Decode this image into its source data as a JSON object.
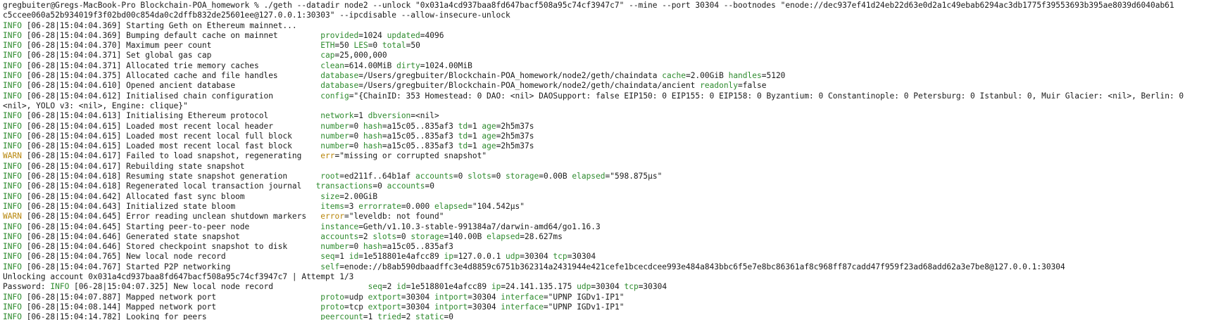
{
  "colors": {
    "info": "#2e8b2e",
    "warn": "#b8860b",
    "text": "#1a1a1a",
    "cursor": "#8a8a8a"
  },
  "lines": [
    {
      "segs": [
        {
          "t": "gregbuiter@Gregs-MacBook-Pro Blockchain-POA_homework % ./geth --datadir node2 --unlock \"0x031a4cd937baa8fd647bacf508a95c74cf3947c7\" --mine --port 30304 --bootnodes \"enode://dec937ef41d24eb22d63e0d2a1c49ebab6294ac3db1775f39553693b395ae8039d6040ab61"
        }
      ]
    },
    {
      "segs": [
        {
          "t": "c5ccee060a52b934019f3f02bd00c854da0c2dffb832de25601ee@127.0.0.1:30303\" --ipcdisable --allow-insecure-unlock"
        }
      ]
    },
    {
      "segs": [
        {
          "t": "INFO",
          "c": "info"
        },
        {
          "t": " [06-28|15:04:04.369] Starting Geth on Ethereum mainnet..."
        }
      ]
    },
    {
      "segs": [
        {
          "t": "INFO",
          "c": "info"
        },
        {
          "t": " [06-28|15:04:04.369] Bumping default cache on mainnet         "
        },
        {
          "t": "provided",
          "c": "k"
        },
        {
          "t": "=1024 "
        },
        {
          "t": "updated",
          "c": "k"
        },
        {
          "t": "=4096"
        }
      ]
    },
    {
      "segs": [
        {
          "t": "INFO",
          "c": "info"
        },
        {
          "t": " [06-28|15:04:04.370] Maximum peer count                       "
        },
        {
          "t": "ETH",
          "c": "k"
        },
        {
          "t": "=50 "
        },
        {
          "t": "LES",
          "c": "k"
        },
        {
          "t": "=0 "
        },
        {
          "t": "total",
          "c": "k"
        },
        {
          "t": "=50"
        }
      ]
    },
    {
      "segs": [
        {
          "t": "INFO",
          "c": "info"
        },
        {
          "t": " [06-28|15:04:04.371] Set global gas cap                       "
        },
        {
          "t": "cap",
          "c": "k"
        },
        {
          "t": "=25,000,000"
        }
      ]
    },
    {
      "segs": [
        {
          "t": "INFO",
          "c": "info"
        },
        {
          "t": " [06-28|15:04:04.371] Allocated trie memory caches             "
        },
        {
          "t": "clean",
          "c": "k"
        },
        {
          "t": "=614.00MiB "
        },
        {
          "t": "dirty",
          "c": "k"
        },
        {
          "t": "=1024.00MiB"
        }
      ]
    },
    {
      "segs": [
        {
          "t": "INFO",
          "c": "info"
        },
        {
          "t": " [06-28|15:04:04.375] Allocated cache and file handles         "
        },
        {
          "t": "database",
          "c": "k"
        },
        {
          "t": "=/Users/gregbuiter/Blockchain-POA_homework/node2/geth/chaindata "
        },
        {
          "t": "cache",
          "c": "k"
        },
        {
          "t": "=2.00GiB "
        },
        {
          "t": "handles",
          "c": "k"
        },
        {
          "t": "=5120"
        }
      ]
    },
    {
      "segs": [
        {
          "t": "INFO",
          "c": "info"
        },
        {
          "t": " [06-28|15:04:04.610] Opened ancient database                  "
        },
        {
          "t": "database",
          "c": "k"
        },
        {
          "t": "=/Users/gregbuiter/Blockchain-POA_homework/node2/geth/chaindata/ancient "
        },
        {
          "t": "readonly",
          "c": "k"
        },
        {
          "t": "=false"
        }
      ]
    },
    {
      "segs": [
        {
          "t": "INFO",
          "c": "info"
        },
        {
          "t": " [06-28|15:04:04.612] Initialised chain configuration          "
        },
        {
          "t": "config",
          "c": "k"
        },
        {
          "t": "=\"{ChainID: 353 Homestead: 0 DAO: <nil> DAOSupport: false EIP150: 0 EIP155: 0 EIP158: 0 Byzantium: 0 Constantinople: 0 Petersburg: 0 Istanbul: 0, Muir Glacier: <nil>, Berlin: 0"
        }
      ]
    },
    {
      "segs": [
        {
          "t": "<nil>, YOLO v3: <nil>, Engine: clique}\""
        }
      ]
    },
    {
      "segs": [
        {
          "t": "INFO",
          "c": "info"
        },
        {
          "t": " [06-28|15:04:04.613] Initialising Ethereum protocol           "
        },
        {
          "t": "network",
          "c": "k"
        },
        {
          "t": "=1 "
        },
        {
          "t": "dbversion",
          "c": "k"
        },
        {
          "t": "=<nil>"
        }
      ]
    },
    {
      "segs": [
        {
          "t": "INFO",
          "c": "info"
        },
        {
          "t": " [06-28|15:04:04.615] Loaded most recent local header          "
        },
        {
          "t": "number",
          "c": "k"
        },
        {
          "t": "=0 "
        },
        {
          "t": "hash",
          "c": "k"
        },
        {
          "t": "=a15c05..835af3 "
        },
        {
          "t": "td",
          "c": "k"
        },
        {
          "t": "=1 "
        },
        {
          "t": "age",
          "c": "k"
        },
        {
          "t": "=2h5m37s"
        }
      ]
    },
    {
      "segs": [
        {
          "t": "INFO",
          "c": "info"
        },
        {
          "t": " [06-28|15:04:04.615] Loaded most recent local full block      "
        },
        {
          "t": "number",
          "c": "k"
        },
        {
          "t": "=0 "
        },
        {
          "t": "hash",
          "c": "k"
        },
        {
          "t": "=a15c05..835af3 "
        },
        {
          "t": "td",
          "c": "k"
        },
        {
          "t": "=1 "
        },
        {
          "t": "age",
          "c": "k"
        },
        {
          "t": "=2h5m37s"
        }
      ]
    },
    {
      "segs": [
        {
          "t": "INFO",
          "c": "info"
        },
        {
          "t": " [06-28|15:04:04.615] Loaded most recent local fast block      "
        },
        {
          "t": "number",
          "c": "k"
        },
        {
          "t": "=0 "
        },
        {
          "t": "hash",
          "c": "k"
        },
        {
          "t": "=a15c05..835af3 "
        },
        {
          "t": "td",
          "c": "k"
        },
        {
          "t": "=1 "
        },
        {
          "t": "age",
          "c": "k"
        },
        {
          "t": "=2h5m37s"
        }
      ]
    },
    {
      "segs": [
        {
          "t": "WARN",
          "c": "warn"
        },
        {
          "t": " [06-28|15:04:04.617] Failed to load snapshot, regenerating    "
        },
        {
          "t": "err",
          "c": "warn"
        },
        {
          "t": "=\"missing or corrupted snapshot\""
        }
      ]
    },
    {
      "segs": [
        {
          "t": "INFO",
          "c": "info"
        },
        {
          "t": " [06-28|15:04:04.617] Rebuilding state snapshot"
        }
      ]
    },
    {
      "segs": [
        {
          "t": "INFO",
          "c": "info"
        },
        {
          "t": " [06-28|15:04:04.618] Resuming state snapshot generation       "
        },
        {
          "t": "root",
          "c": "k"
        },
        {
          "t": "=ed211f..64b1af "
        },
        {
          "t": "accounts",
          "c": "k"
        },
        {
          "t": "=0 "
        },
        {
          "t": "slots",
          "c": "k"
        },
        {
          "t": "=0 "
        },
        {
          "t": "storage",
          "c": "k"
        },
        {
          "t": "=0.00B "
        },
        {
          "t": "elapsed",
          "c": "k"
        },
        {
          "t": "=\"598.875µs\""
        }
      ]
    },
    {
      "segs": [
        {
          "t": "INFO",
          "c": "info"
        },
        {
          "t": " [06-28|15:04:04.618] Regenerated local transaction journal   "
        },
        {
          "t": "transactions",
          "c": "k"
        },
        {
          "t": "=0 "
        },
        {
          "t": "accounts",
          "c": "k"
        },
        {
          "t": "=0"
        }
      ]
    },
    {
      "segs": [
        {
          "t": "INFO",
          "c": "info"
        },
        {
          "t": " [06-28|15:04:04.642] Allocated fast sync bloom                "
        },
        {
          "t": "size",
          "c": "k"
        },
        {
          "t": "=2.00GiB"
        }
      ]
    },
    {
      "segs": [
        {
          "t": "INFO",
          "c": "info"
        },
        {
          "t": " [06-28|15:04:04.643] Initialized state bloom                  "
        },
        {
          "t": "items",
          "c": "k"
        },
        {
          "t": "=3 "
        },
        {
          "t": "errorrate",
          "c": "k"
        },
        {
          "t": "=0.000 "
        },
        {
          "t": "elapsed",
          "c": "k"
        },
        {
          "t": "=\"104.542µs\""
        }
      ]
    },
    {
      "segs": [
        {
          "t": "WARN",
          "c": "warn"
        },
        {
          "t": " [06-28|15:04:04.645] Error reading unclean shutdown markers   "
        },
        {
          "t": "error",
          "c": "warn"
        },
        {
          "t": "=\"leveldb: not found\""
        }
      ]
    },
    {
      "segs": [
        {
          "t": "INFO",
          "c": "info"
        },
        {
          "t": " [06-28|15:04:04.645] Starting peer-to-peer node               "
        },
        {
          "t": "instance",
          "c": "k"
        },
        {
          "t": "=Geth/v1.10.3-stable-991384a7/darwin-amd64/go1.16.3"
        }
      ]
    },
    {
      "segs": [
        {
          "t": "INFO",
          "c": "info"
        },
        {
          "t": " [06-28|15:04:04.646] Generated state snapshot                 "
        },
        {
          "t": "accounts",
          "c": "k"
        },
        {
          "t": "=2 "
        },
        {
          "t": "slots",
          "c": "k"
        },
        {
          "t": "=0 "
        },
        {
          "t": "storage",
          "c": "k"
        },
        {
          "t": "=140.00B "
        },
        {
          "t": "elapsed",
          "c": "k"
        },
        {
          "t": "=28.627ms"
        }
      ]
    },
    {
      "segs": [
        {
          "t": "INFO",
          "c": "info"
        },
        {
          "t": " [06-28|15:04:04.646] Stored checkpoint snapshot to disk       "
        },
        {
          "t": "number",
          "c": "k"
        },
        {
          "t": "=0 "
        },
        {
          "t": "hash",
          "c": "k"
        },
        {
          "t": "=a15c05..835af3"
        }
      ]
    },
    {
      "segs": [
        {
          "t": "INFO",
          "c": "info"
        },
        {
          "t": " [06-28|15:04:04.765] New local node record                    "
        },
        {
          "t": "seq",
          "c": "k"
        },
        {
          "t": "=1 "
        },
        {
          "t": "id",
          "c": "k"
        },
        {
          "t": "=1e518801e4afcc89 "
        },
        {
          "t": "ip",
          "c": "k"
        },
        {
          "t": "=127.0.0.1 "
        },
        {
          "t": "udp",
          "c": "k"
        },
        {
          "t": "=30304 "
        },
        {
          "t": "tcp",
          "c": "k"
        },
        {
          "t": "=30304"
        }
      ]
    },
    {
      "segs": [
        {
          "t": "INFO",
          "c": "info"
        },
        {
          "t": " [06-28|15:04:04.767] Started P2P networking                   "
        },
        {
          "t": "self",
          "c": "k"
        },
        {
          "t": "=enode://b8ab590dbaadffc3e4d8859c6751b362314a2431944e421cefe1bcecdcee993e484a843bbc6f5e7e8bc86361af8c968ff87cadd47f959f23ad68add62a3e7be8@127.0.0.1:30304"
        }
      ]
    },
    {
      "segs": [
        {
          "t": "Unlocking account 0x031a4cd937baa8fd647bacf508a95c74cf3947c7 | Attempt 1/3"
        }
      ]
    },
    {
      "segs": [
        {
          "t": "Password: "
        },
        {
          "t": "INFO",
          "c": "info"
        },
        {
          "t": " [06-28|15:04:07.325] New local node record                    "
        },
        {
          "t": "seq",
          "c": "k"
        },
        {
          "t": "=2 "
        },
        {
          "t": "id",
          "c": "k"
        },
        {
          "t": "=1e518801e4afcc89 "
        },
        {
          "t": "ip",
          "c": "k"
        },
        {
          "t": "=24.141.135.175 "
        },
        {
          "t": "udp",
          "c": "k"
        },
        {
          "t": "=30304 "
        },
        {
          "t": "tcp",
          "c": "k"
        },
        {
          "t": "=30304"
        }
      ]
    },
    {
      "segs": [
        {
          "t": "INFO",
          "c": "info"
        },
        {
          "t": " [06-28|15:04:07.887] Mapped network port                      "
        },
        {
          "t": "proto",
          "c": "k"
        },
        {
          "t": "=udp "
        },
        {
          "t": "extport",
          "c": "k"
        },
        {
          "t": "=30304 "
        },
        {
          "t": "intport",
          "c": "k"
        },
        {
          "t": "=30304 "
        },
        {
          "t": "interface",
          "c": "k"
        },
        {
          "t": "=\"UPNP IGDv1-IP1\""
        }
      ]
    },
    {
      "segs": [
        {
          "t": "INFO",
          "c": "info"
        },
        {
          "t": " [06-28|15:04:08.144] Mapped network port                      "
        },
        {
          "t": "proto",
          "c": "k"
        },
        {
          "t": "=tcp "
        },
        {
          "t": "extport",
          "c": "k"
        },
        {
          "t": "=30304 "
        },
        {
          "t": "intport",
          "c": "k"
        },
        {
          "t": "=30304 "
        },
        {
          "t": "interface",
          "c": "k"
        },
        {
          "t": "=\"UPNP IGDv1-IP1\""
        }
      ]
    },
    {
      "segs": [
        {
          "t": "INFO",
          "c": "info"
        },
        {
          "t": " [06-28|15:04:14.782] Looking for peers                        "
        },
        {
          "t": "peercount",
          "c": "k"
        },
        {
          "t": "=1 "
        },
        {
          "t": "tried",
          "c": "k"
        },
        {
          "t": "=2 "
        },
        {
          "t": "static",
          "c": "k"
        },
        {
          "t": "=0"
        }
      ]
    }
  ]
}
